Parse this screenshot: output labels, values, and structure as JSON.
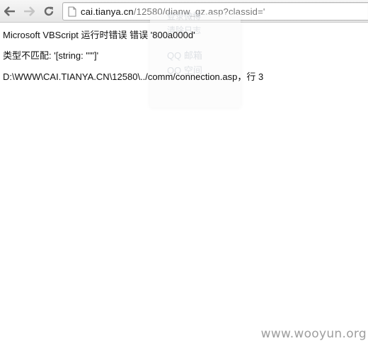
{
  "toolbar": {
    "back_icon": "back-arrow-icon",
    "forward_icon": "forward-arrow-icon",
    "reload_icon": "reload-icon",
    "url_host": "cai.tianya.cn",
    "url_path": "/12580/dianw_gz.asp?classid='"
  },
  "page": {
    "error_title": "Microsoft VBScript 运行时错误 错误 '800a000d'",
    "error_type": "类型不匹配: '[string: \"'\"]'",
    "error_location": "D:\\WWW\\CAI.TIANYA.CN\\12580\\../comm/connection.asp，行 3"
  },
  "ghost_menu": {
    "items": [
      "登录微博",
      "清除日志",
      "QQ 邮箱",
      "QQ 空间"
    ]
  },
  "watermark": "www.wooyun.org",
  "colors": {
    "toolbar_bg": "#ececec",
    "text": "#111111",
    "url_path": "#777777",
    "watermark": "#9e9e9e"
  }
}
